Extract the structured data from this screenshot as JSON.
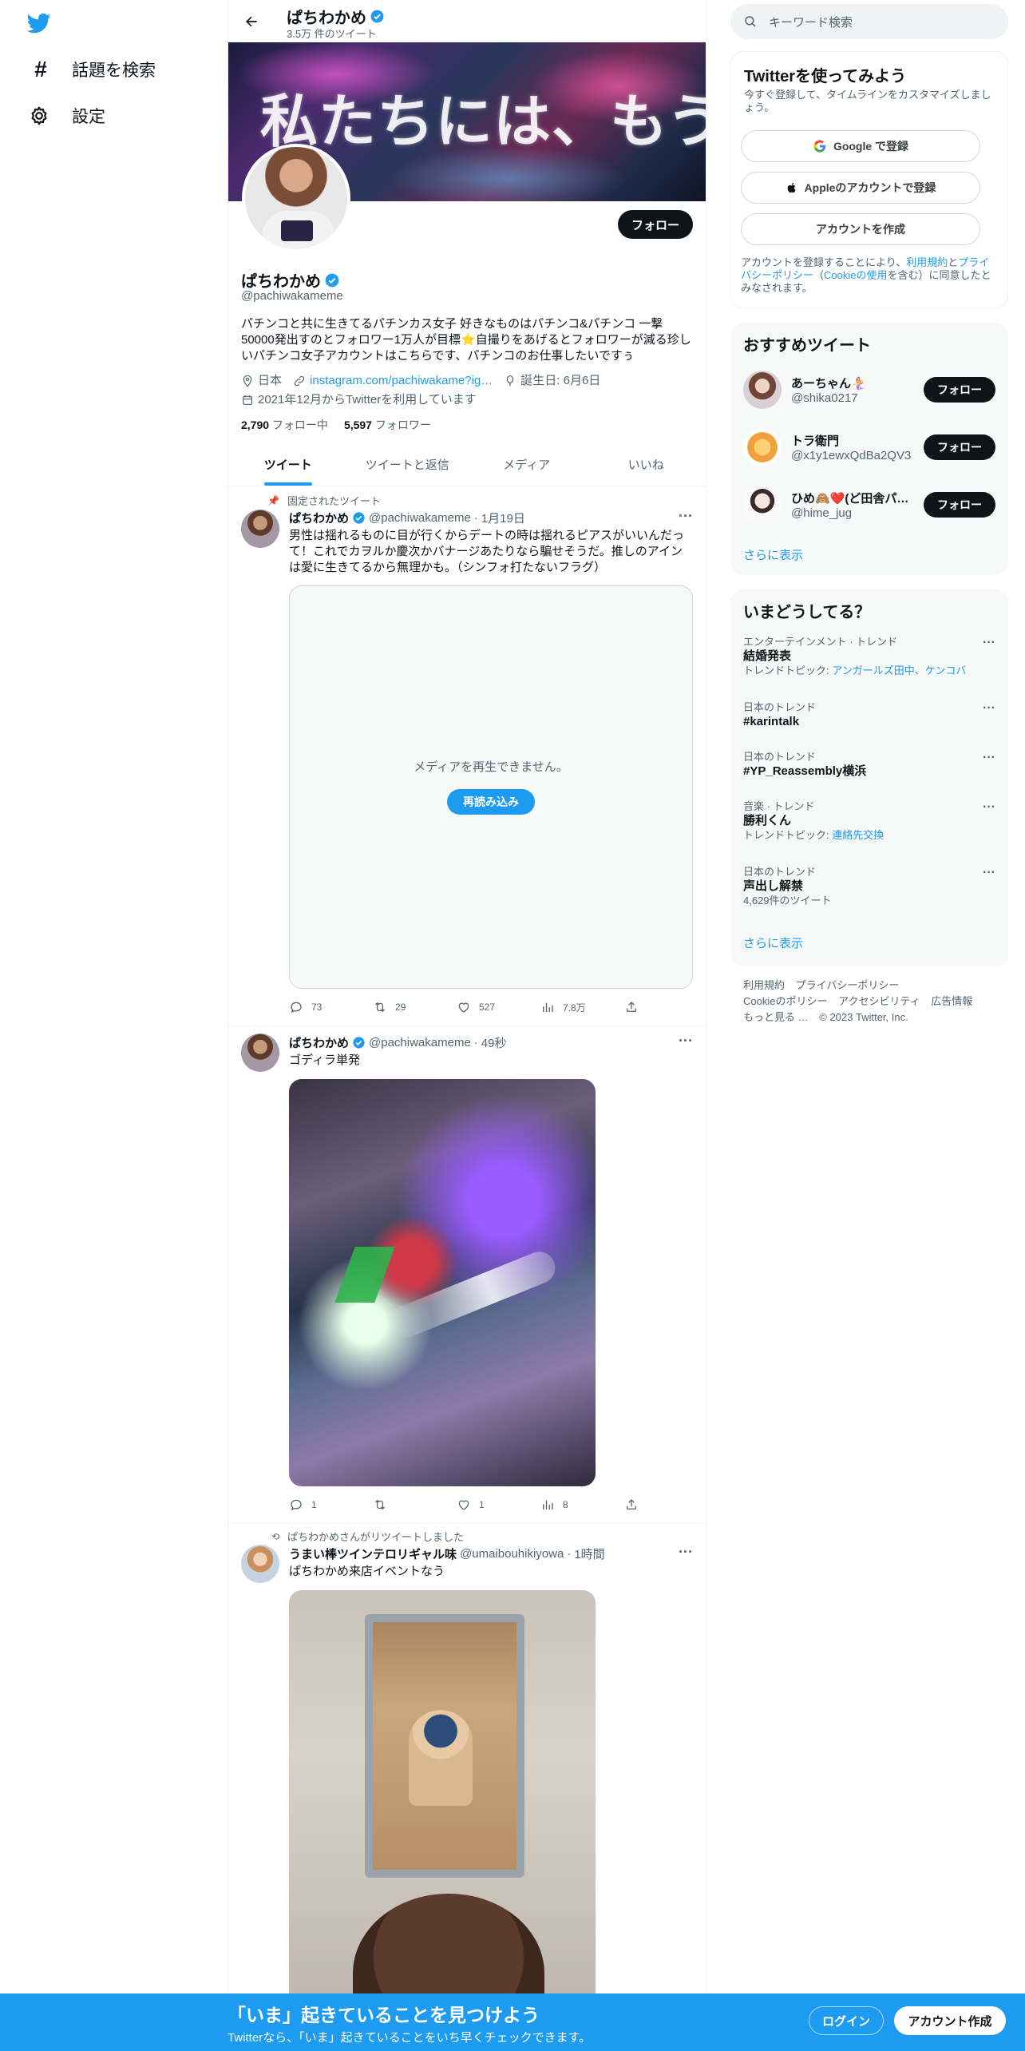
{
  "nav": {
    "explore_label": "話題を検索",
    "settings_label": "設定"
  },
  "header": {
    "name": "ぱちわかめ",
    "tweet_count": "3.5万 件のツイート"
  },
  "profile": {
    "banner_text": "私たちには、もう",
    "follow_label": "フォロー",
    "name": "ぱちわかめ",
    "handle": "@pachiwakameme",
    "bio": "パチンコと共に生きてるパチンカス女子 好きなものはパチンコ&パチンコ 一撃50000発出すのとフォロワー1万人が目標⭐自撮りをあげるとフォロワーが減る珍しいパチンコ女子アカウントはこちらです、パチンコのお仕事したいですぅ",
    "location": "日本",
    "link": "instagram.com/pachiwakame?ig…",
    "birthday": "誕生日: 6月6日",
    "joined": "2021年12月からTwitterを利用しています",
    "following_count": "2,790",
    "following_label": "フォロー中",
    "followers_count": "5,597",
    "followers_label": "フォロワー"
  },
  "tabs": [
    "ツイート",
    "ツイートと返信",
    "メディア",
    "いいね"
  ],
  "tweets": [
    {
      "context": "固定されたツイート",
      "name": "ぱちわかめ",
      "handle": "@pachiwakameme",
      "time": "1月19日",
      "text": "男性は揺れるものに目が行くからデートの時は揺れるピアスがいいんだって！これでカヲルか慶次かバナージあたりなら騙せそうだ。推しのアインは愛に生きてるから無理かも。（シンフォ打たないフラグ）",
      "media_error": "メディアを再生できません。",
      "reload_label": "再読み込み",
      "replies": "73",
      "retweets": "29",
      "likes": "527",
      "views": "7.8万"
    },
    {
      "name": "ぱちわかめ",
      "handle": "@pachiwakameme",
      "time": "49秒",
      "text": "ゴディラ単発",
      "replies": "1",
      "retweets": "",
      "likes": "1",
      "views": "8"
    },
    {
      "context": "ぱちわかめさんがリツイートしました",
      "name": "うまい棒ツインテロリギャル味",
      "handle": "@umaibouhikiyowa",
      "time": "1時間",
      "text": "ぱちわかめ来店イベントなう"
    }
  ],
  "right": {
    "search_placeholder": "キーワード検索",
    "signup": {
      "title": "Twitterを使ってみよう",
      "subtitle": "今すぐ登録して、タイムラインをカスタマイズしましょう。",
      "google_label": "Google で登録",
      "apple_label": "Appleのアカウントで登録",
      "create_label": "アカウントを作成",
      "legal_prefix": "アカウントを登録することにより、",
      "legal_terms": "利用規約",
      "legal_and": "と",
      "legal_privacy": "プライバシーポリシー",
      "legal_paren_open": "（",
      "legal_cookie": "Cookieの使用",
      "legal_suffix": "を含む）に同意したとみなされます。"
    },
    "who_to_follow": {
      "title": "おすすめツイート",
      "users": [
        {
          "name": "あーちゃん🧜‍♀️",
          "handle": "@shika0217",
          "follow": "フォロー"
        },
        {
          "name": "トラ衛門",
          "handle": "@x1y1ewxQdBa2QV3",
          "follow": "フォロー"
        },
        {
          "name": "ひめ🙈❤️(ど田舎パ…",
          "handle": "@hime_jug",
          "follow": "フォロー"
        }
      ],
      "show_more": "さらに表示"
    },
    "trends": {
      "title": "いまどうしてる？",
      "items": [
        {
          "category": "エンターテインメント · トレンド",
          "title": "結婚発表",
          "sub_prefix": "トレンドトピック: ",
          "sub_links": "アンガールズ田中、ケンコバ"
        },
        {
          "category": "日本のトレンド",
          "title": "#karintalk",
          "sub_prefix": "",
          "sub_links": ""
        },
        {
          "category": "日本のトレンド",
          "title": "#YP_Reassembly横浜",
          "sub_prefix": "",
          "sub_links": ""
        },
        {
          "category": "音楽 · トレンド",
          "title": "勝利くん",
          "sub_prefix": "トレンドトピック: ",
          "sub_links": "連絡先交換"
        },
        {
          "category": "日本のトレンド",
          "title": "声出し解禁",
          "sub_prefix": "4,629件のツイート",
          "sub_links": ""
        }
      ],
      "show_more": "さらに表示"
    },
    "footer": {
      "line1": [
        "利用規約",
        "プライバシーポリシー"
      ],
      "line2": [
        "Cookieのポリシー",
        "アクセシビリティ",
        "広告情報"
      ],
      "more": "もっと見る …",
      "copyright": "© 2023 Twitter, Inc."
    }
  },
  "bottom_bar": {
    "title": "「いま」起きていることを見つけよう",
    "subtitle": "Twitterなら、「いま」起きていることをいち早くチェックできます。",
    "login_label": "ログイン",
    "signup_label": "アカウント作成"
  },
  "colors": {
    "accent": "#1d9bf0",
    "text": "#0f1419",
    "muted": "#536471"
  }
}
